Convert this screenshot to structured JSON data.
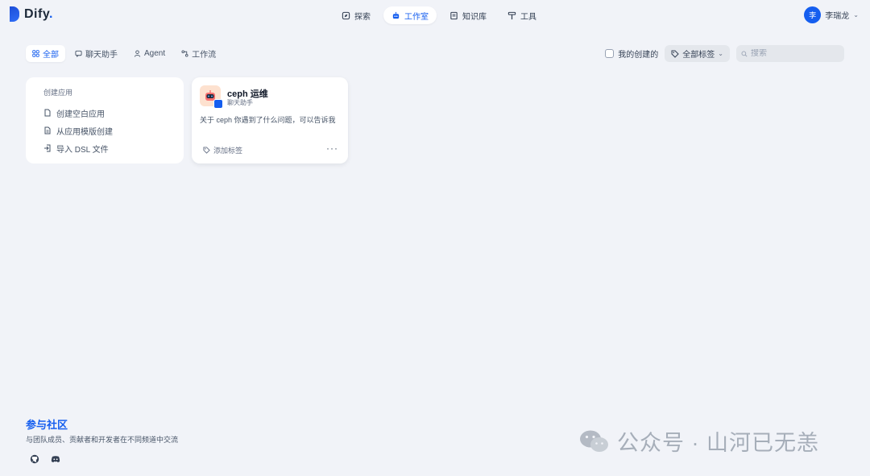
{
  "brand": {
    "name": "Dify",
    "dot": "."
  },
  "nav": [
    {
      "label": "探索",
      "icon": "compass-icon"
    },
    {
      "label": "工作室",
      "icon": "robot-icon",
      "active": true
    },
    {
      "label": "知识库",
      "icon": "book-icon"
    },
    {
      "label": "工具",
      "icon": "hammer-icon"
    }
  ],
  "user": {
    "avatar": "李",
    "name": "李瑞龙"
  },
  "tabs": [
    {
      "label": "全部",
      "active": true
    },
    {
      "label": "聊天助手"
    },
    {
      "label": "Agent"
    },
    {
      "label": "工作流"
    }
  ],
  "filters": {
    "created_by_me": "我的创建的",
    "all_tags": "全部标签",
    "search_placeholder": "搜索"
  },
  "create": {
    "title": "创建应用",
    "items": [
      "创建空白应用",
      "从应用模版创建",
      "导入 DSL 文件"
    ]
  },
  "apps": [
    {
      "name": "ceph 运维",
      "type": "聊天助手",
      "description": "关于 ceph 你遇到了什么问题，可以告诉我",
      "tag_label": "添加标签"
    }
  ],
  "community": {
    "title": "参与社区",
    "subtitle": "与团队成员、贡献者和开发者在不同频道中交流"
  },
  "watermark": "公众号 · 山河已无恙",
  "colors": {
    "accent": "#155eef",
    "background": "#f1f3f8"
  }
}
